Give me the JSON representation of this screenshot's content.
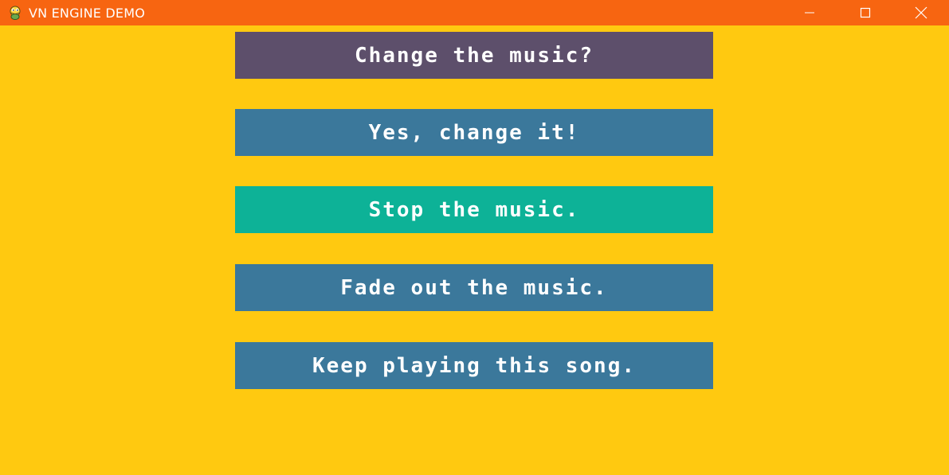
{
  "window": {
    "title": "VN ENGINE DEMO",
    "icon": "python-snake-icon",
    "titlebar_color": "#F76511",
    "controls": [
      "minimize-icon",
      "maximize-icon",
      "close-icon"
    ]
  },
  "scene": {
    "background_color": "#FFC910",
    "prompt": "Change the music?",
    "choices": [
      {
        "label": "Yes, change it!",
        "state": "normal"
      },
      {
        "label": "Stop the music.",
        "state": "hover"
      },
      {
        "label": "Fade out the music.",
        "state": "normal"
      },
      {
        "label": "Keep playing this song.",
        "state": "normal"
      }
    ]
  },
  "colors": {
    "prompt_bg": "#5D4F6B",
    "choice_bg": "#3B789B",
    "choice_hover_bg": "#0DB297",
    "text": "#FFFFFF"
  }
}
